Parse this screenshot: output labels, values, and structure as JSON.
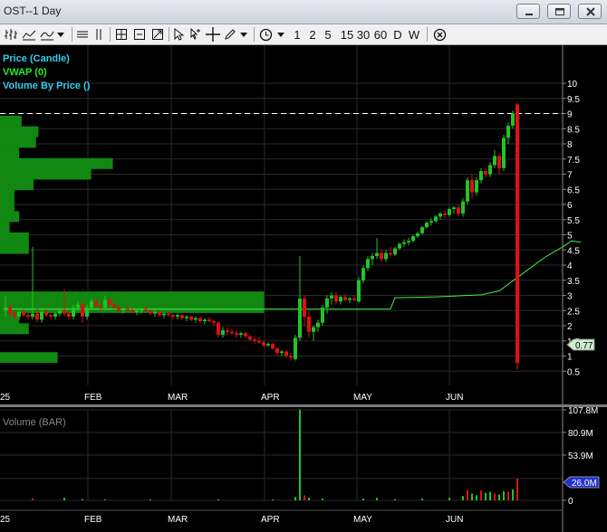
{
  "window": {
    "title": "OST--1 Day"
  },
  "toolbar": {
    "periods": [
      "1",
      "2",
      "5",
      "15",
      "30",
      "60",
      "D",
      "W"
    ]
  },
  "colors": {
    "up": "#22c422",
    "down": "#dd1111",
    "vwap": "#44ee44",
    "legend_cyan": "#33ccee",
    "legend_green": "#22ee22",
    "vbp": "#118811"
  },
  "chart_data": [
    {
      "type": "candlestick",
      "legend": [
        "Price (Candle)",
        "VWAP (0)",
        "Volume By Price ()"
      ],
      "x_ticks": [
        "25",
        "FEB",
        "MAR",
        "APR",
        "MAY",
        "JUN"
      ],
      "y_ticks": [
        "10",
        "9.5",
        "9",
        "8.5",
        "8",
        "7.5",
        "7",
        "6.5",
        "6",
        "5.5",
        "5",
        "4.5",
        "4",
        "3.5",
        "3",
        "2.5",
        "2",
        "1.5",
        "1",
        "0.5"
      ],
      "ylim": [
        0.3,
        10.3
      ],
      "last_price_label": "0.77",
      "dashed_level": 9.0,
      "vwap": [
        [
          0,
          2.55
        ],
        [
          48,
          2.55
        ],
        [
          85,
          2.55
        ],
        [
          86,
          2.92
        ],
        [
          95,
          2.95
        ],
        [
          105,
          3.02
        ],
        [
          109,
          3.15
        ],
        [
          114,
          3.7
        ],
        [
          119,
          4.25
        ],
        [
          123,
          4.6
        ],
        [
          125,
          4.8
        ],
        [
          127,
          4.75
        ]
      ],
      "volume_by_price": [
        {
          "price": 8.75,
          "volume": 9
        },
        {
          "price": 8.4,
          "volume": 16
        },
        {
          "price": 8.05,
          "volume": 15
        },
        {
          "price": 7.7,
          "volume": 8
        },
        {
          "price": 7.35,
          "volume": 47
        },
        {
          "price": 7.0,
          "volume": 38
        },
        {
          "price": 6.65,
          "volume": 14
        },
        {
          "price": 6.3,
          "volume": 6
        },
        {
          "price": 5.95,
          "volume": 6
        },
        {
          "price": 5.6,
          "volume": 8
        },
        {
          "price": 5.25,
          "volume": 4
        },
        {
          "price": 4.9,
          "volume": 12
        },
        {
          "price": 4.55,
          "volume": 12
        },
        {
          "price": 2.95,
          "volume": 110
        },
        {
          "price": 2.6,
          "volume": 110
        },
        {
          "price": 2.25,
          "volume": 8
        },
        {
          "price": 1.9,
          "volume": 12
        },
        {
          "price": 0.95,
          "volume": 24
        }
      ],
      "candles": [
        [
          0,
          2.5,
          3.0,
          2.3,
          2.6
        ],
        [
          1,
          2.6,
          2.7,
          2.3,
          2.4
        ],
        [
          2,
          2.4,
          2.5,
          2.2,
          2.3
        ],
        [
          3,
          2.3,
          2.5,
          2.2,
          2.45
        ],
        [
          4,
          2.45,
          2.55,
          2.3,
          2.35
        ],
        [
          5,
          2.35,
          2.45,
          2.2,
          2.3
        ],
        [
          6,
          2.3,
          4.6,
          2.2,
          2.4
        ],
        [
          7,
          2.4,
          2.6,
          2.1,
          2.2
        ],
        [
          8,
          2.2,
          2.5,
          2.1,
          2.45
        ],
        [
          9,
          2.45,
          2.55,
          2.3,
          2.35
        ],
        [
          10,
          2.35,
          2.45,
          2.2,
          2.3
        ],
        [
          11,
          2.3,
          2.45,
          2.2,
          2.4
        ],
        [
          12,
          2.4,
          2.6,
          2.3,
          2.5
        ],
        [
          13,
          2.5,
          3.2,
          2.3,
          2.4
        ],
        [
          14,
          2.4,
          2.5,
          2.2,
          2.3
        ],
        [
          15,
          2.3,
          2.7,
          2.2,
          2.6
        ],
        [
          16,
          2.6,
          2.8,
          2.5,
          2.7
        ],
        [
          17,
          2.7,
          2.8,
          2.1,
          2.3
        ],
        [
          18,
          2.3,
          2.7,
          2.2,
          2.6
        ],
        [
          19,
          2.6,
          2.9,
          2.5,
          2.8
        ],
        [
          20,
          2.8,
          2.9,
          2.6,
          2.65
        ],
        [
          21,
          2.65,
          2.75,
          2.5,
          2.6
        ],
        [
          22,
          2.6,
          3.0,
          2.5,
          2.85
        ],
        [
          23,
          2.85,
          2.95,
          2.6,
          2.7
        ],
        [
          24,
          2.7,
          2.8,
          2.55,
          2.6
        ],
        [
          25,
          2.6,
          2.7,
          2.45,
          2.5
        ],
        [
          26,
          2.5,
          2.6,
          2.4,
          2.55
        ],
        [
          27,
          2.55,
          2.65,
          2.45,
          2.5
        ],
        [
          28,
          2.5,
          2.6,
          2.4,
          2.45
        ],
        [
          29,
          2.45,
          2.55,
          2.35,
          2.5
        ],
        [
          30,
          2.5,
          2.6,
          2.4,
          2.55
        ],
        [
          31,
          2.55,
          2.65,
          2.45,
          2.5
        ],
        [
          32,
          2.5,
          2.55,
          2.35,
          2.4
        ],
        [
          33,
          2.4,
          2.5,
          2.3,
          2.45
        ],
        [
          34,
          2.45,
          2.5,
          2.3,
          2.35
        ],
        [
          35,
          2.35,
          2.45,
          2.25,
          2.4
        ],
        [
          36,
          2.4,
          2.5,
          2.3,
          2.35
        ],
        [
          37,
          2.35,
          2.4,
          2.2,
          2.3
        ],
        [
          38,
          2.3,
          2.4,
          2.2,
          2.35
        ],
        [
          39,
          2.35,
          2.4,
          2.2,
          2.25
        ],
        [
          40,
          2.25,
          2.35,
          2.15,
          2.3
        ],
        [
          41,
          2.3,
          2.35,
          2.15,
          2.2
        ],
        [
          42,
          2.2,
          2.3,
          2.1,
          2.25
        ],
        [
          43,
          2.25,
          2.3,
          2.1,
          2.15
        ],
        [
          44,
          2.15,
          2.25,
          2.05,
          2.2
        ],
        [
          45,
          2.2,
          2.3,
          2.1,
          2.15
        ],
        [
          46,
          2.15,
          2.2,
          2.0,
          2.1
        ],
        [
          47,
          2.1,
          2.15,
          1.6,
          1.7
        ],
        [
          48,
          1.7,
          1.95,
          1.6,
          1.85
        ],
        [
          49,
          1.85,
          1.95,
          1.7,
          1.8
        ],
        [
          50,
          1.8,
          1.9,
          1.7,
          1.75
        ],
        [
          51,
          1.75,
          1.85,
          1.6,
          1.7
        ],
        [
          52,
          1.7,
          1.8,
          1.6,
          1.75
        ],
        [
          53,
          1.75,
          1.8,
          1.6,
          1.65
        ],
        [
          54,
          1.65,
          1.7,
          1.5,
          1.55
        ],
        [
          55,
          1.55,
          1.65,
          1.4,
          1.5
        ],
        [
          56,
          1.5,
          1.6,
          1.4,
          1.45
        ],
        [
          57,
          1.45,
          1.5,
          1.3,
          1.35
        ],
        [
          58,
          1.35,
          1.45,
          1.3,
          1.4
        ],
        [
          59,
          1.4,
          1.45,
          1.2,
          1.25
        ],
        [
          60,
          1.25,
          1.3,
          1.0,
          1.1
        ],
        [
          61,
          1.1,
          1.2,
          1.0,
          1.15
        ],
        [
          62,
          1.15,
          1.2,
          0.95,
          1.0
        ],
        [
          63,
          1.0,
          1.1,
          0.85,
          0.95
        ],
        [
          64,
          0.9,
          1.7,
          0.85,
          1.6
        ],
        [
          65,
          1.6,
          4.3,
          1.5,
          2.9
        ],
        [
          66,
          2.9,
          3.0,
          2.0,
          2.3
        ],
        [
          67,
          2.3,
          2.5,
          1.6,
          1.8
        ],
        [
          68,
          1.8,
          2.0,
          1.5,
          1.95
        ],
        [
          69,
          1.95,
          2.2,
          1.8,
          2.1
        ],
        [
          70,
          2.1,
          2.7,
          2.0,
          2.6
        ],
        [
          71,
          2.6,
          3.0,
          2.4,
          2.9
        ],
        [
          72,
          2.9,
          3.1,
          2.7,
          3.0
        ],
        [
          73,
          3.0,
          3.1,
          2.7,
          2.8
        ],
        [
          74,
          2.8,
          3.0,
          2.7,
          2.95
        ],
        [
          75,
          2.95,
          3.05,
          2.8,
          2.85
        ],
        [
          76,
          2.85,
          2.95,
          2.75,
          2.9
        ],
        [
          77,
          2.9,
          3.0,
          2.8,
          2.85
        ],
        [
          78,
          2.8,
          3.6,
          2.75,
          3.5
        ],
        [
          79,
          3.5,
          4.0,
          3.4,
          3.9
        ],
        [
          80,
          3.9,
          4.3,
          3.8,
          4.2
        ],
        [
          81,
          4.2,
          4.4,
          4.0,
          4.3
        ],
        [
          82,
          4.3,
          4.9,
          4.2,
          4.4
        ],
        [
          83,
          4.4,
          4.5,
          4.1,
          4.2
        ],
        [
          84,
          4.2,
          4.5,
          4.1,
          4.4
        ],
        [
          85,
          4.4,
          4.6,
          4.3,
          4.35
        ],
        [
          86,
          4.35,
          4.6,
          4.3,
          4.55
        ],
        [
          87,
          4.55,
          4.75,
          4.5,
          4.7
        ],
        [
          88,
          4.7,
          4.85,
          4.6,
          4.75
        ],
        [
          89,
          4.75,
          4.9,
          4.65,
          4.8
        ],
        [
          90,
          4.8,
          5.0,
          4.75,
          4.95
        ],
        [
          91,
          4.95,
          5.1,
          4.9,
          5.05
        ],
        [
          92,
          5.05,
          5.3,
          5.0,
          5.25
        ],
        [
          93,
          5.25,
          5.45,
          5.2,
          5.4
        ],
        [
          94,
          5.4,
          5.55,
          5.3,
          5.45
        ],
        [
          95,
          5.45,
          5.65,
          5.4,
          5.6
        ],
        [
          96,
          5.6,
          5.75,
          5.5,
          5.7
        ],
        [
          97,
          5.7,
          5.8,
          5.55,
          5.65
        ],
        [
          98,
          5.65,
          5.9,
          5.6,
          5.85
        ],
        [
          99,
          5.85,
          5.95,
          5.7,
          5.9
        ],
        [
          100,
          5.9,
          6.0,
          5.6,
          5.7
        ],
        [
          101,
          5.7,
          6.2,
          5.6,
          6.1
        ],
        [
          102,
          6.1,
          6.9,
          6.0,
          6.8
        ],
        [
          103,
          6.8,
          7.0,
          6.2,
          6.4
        ],
        [
          104,
          6.4,
          6.9,
          6.3,
          6.8
        ],
        [
          105,
          6.8,
          7.2,
          6.7,
          7.1
        ],
        [
          106,
          7.1,
          7.2,
          6.9,
          7.0
        ],
        [
          107,
          7.0,
          7.4,
          6.9,
          7.3
        ],
        [
          108,
          7.3,
          7.8,
          7.2,
          7.6
        ],
        [
          109,
          7.6,
          7.7,
          7.0,
          7.2
        ],
        [
          110,
          7.2,
          8.3,
          7.1,
          8.2
        ],
        [
          111,
          8.2,
          8.7,
          8.0,
          8.6
        ],
        [
          112,
          8.6,
          9.1,
          8.5,
          9.0
        ],
        [
          113,
          9.3,
          9.35,
          0.55,
          0.77
        ]
      ]
    },
    {
      "type": "bar",
      "legend": [
        "Volume (BAR)"
      ],
      "x_ticks": [
        "25",
        "FEB",
        "MAR",
        "APR",
        "MAY",
        "JUN"
      ],
      "y_ticks": [
        "107.8M",
        "80.9M",
        "53.9M",
        "26.0M",
        "0"
      ],
      "ylim": [
        0,
        107.8
      ],
      "last_volume_label": "26.0M",
      "bars": [
        [
          6,
          2.5
        ],
        [
          13,
          3
        ],
        [
          17,
          1.5
        ],
        [
          22,
          1.2
        ],
        [
          32,
          1.0
        ],
        [
          47,
          1.3
        ],
        [
          59,
          1.1
        ],
        [
          64,
          4
        ],
        [
          65,
          107.8
        ],
        [
          66,
          6
        ],
        [
          67,
          3
        ],
        [
          70,
          2
        ],
        [
          79,
          2
        ],
        [
          82,
          3
        ],
        [
          86,
          1.5
        ],
        [
          92,
          2
        ],
        [
          98,
          3
        ],
        [
          101,
          5
        ],
        [
          102,
          12
        ],
        [
          103,
          8
        ],
        [
          104,
          6
        ],
        [
          105,
          12
        ],
        [
          106,
          9
        ],
        [
          107,
          10
        ],
        [
          108,
          8
        ],
        [
          109,
          7
        ],
        [
          110,
          11
        ],
        [
          111,
          10
        ],
        [
          112,
          13
        ],
        [
          113,
          26
        ]
      ]
    }
  ]
}
